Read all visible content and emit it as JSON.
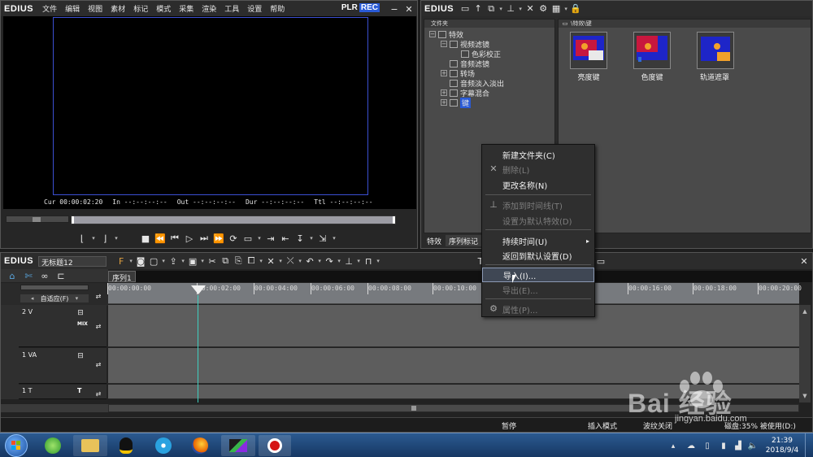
{
  "player": {
    "brand": "EDIUS",
    "menu": [
      "文件",
      "编辑",
      "视图",
      "素材",
      "标记",
      "模式",
      "采集",
      "渲染",
      "工具",
      "设置",
      "帮助"
    ],
    "plr": "PLR",
    "rec": "REC",
    "timecodes": {
      "cur_label": "Cur",
      "cur": "00:00:02:20",
      "in_label": "In",
      "in": "--:--:--:--",
      "out_label": "Out",
      "out": "--:--:--:--",
      "dur_label": "Dur",
      "dur": "--:--:--:--",
      "ttl_label": "Ttl",
      "ttl": "--:--:--:--"
    }
  },
  "effects": {
    "brand": "EDIUS",
    "folder_header": "文件夹",
    "path": "\\特效\\键",
    "tree": [
      {
        "label": "特效",
        "level": 0,
        "expander": "−"
      },
      {
        "label": "视频滤镜",
        "level": 1,
        "expander": "−"
      },
      {
        "label": "色彩校正",
        "level": 2,
        "expander": ""
      },
      {
        "label": "音频滤镜",
        "level": 1,
        "expander": ""
      },
      {
        "label": "转场",
        "level": 1,
        "expander": "+"
      },
      {
        "label": "音频淡入淡出",
        "level": 1,
        "expander": ""
      },
      {
        "label": "字幕混合",
        "level": 1,
        "expander": "+"
      },
      {
        "label": "键",
        "level": 1,
        "expander": "+"
      }
    ],
    "items": [
      {
        "label": "亮度键"
      },
      {
        "label": "色度键"
      },
      {
        "label": "轨道遮罩"
      }
    ],
    "tabs": [
      "特效",
      "序列标记"
    ]
  },
  "context_menu": [
    {
      "label": "新建文件夹(C)",
      "disabled": false,
      "icon": ""
    },
    {
      "label": "删除(L)",
      "disabled": true,
      "icon": "close-icon"
    },
    {
      "label": "更改名称(N)",
      "disabled": false,
      "icon": ""
    },
    {
      "label": "添加到时间线(T)",
      "disabled": true,
      "icon": "add-to-timeline-icon"
    },
    {
      "label": "设置为默认特效(D)",
      "disabled": true,
      "icon": ""
    },
    {
      "label": "持续时间(U)",
      "disabled": false,
      "icon": "",
      "submenu": true
    },
    {
      "label": "返回到默认设置(D)",
      "disabled": false,
      "icon": ""
    },
    {
      "label": "导入(I)...",
      "disabled": false,
      "icon": "",
      "highlighted": true
    },
    {
      "label": "导出(E)...",
      "disabled": true,
      "icon": ""
    },
    {
      "label": "属性(P)...",
      "disabled": true,
      "icon": "properties-icon"
    }
  ],
  "timeline": {
    "brand": "EDIUS",
    "project_name": "无标题12",
    "sequence_tab": "序列1",
    "mode": "自适应(F)",
    "ticks": [
      "00:00:00:00",
      "00:00:02:00",
      "00:00:04:00",
      "00:00:06:00",
      "00:00:08:00",
      "00:00:10:00",
      "00:00:16:00",
      "00:00:18:00",
      "00:00:20:00"
    ],
    "tracks": [
      {
        "name": "2 V",
        "badge": "MIX"
      },
      {
        "name": "1 VA",
        "badge": ""
      },
      {
        "name": "1 T",
        "badge": "T"
      }
    ]
  },
  "status": {
    "pause": "暂停",
    "insert_mode": "插入模式",
    "ripple": "波纹关闭",
    "disk": "磁盘:35% 被使用(D:)"
  },
  "taskbar": {
    "time": "21:39",
    "date": "2018/9/4"
  },
  "watermark": {
    "brand": "Bai 经验",
    "url": "jingyan.baidu.com"
  },
  "colors": {
    "accent_blue": "#1e4fd0",
    "track_body": "#5d5d5d",
    "playhead": "#3fd0c0",
    "taskbar": "#1a3f6e"
  }
}
